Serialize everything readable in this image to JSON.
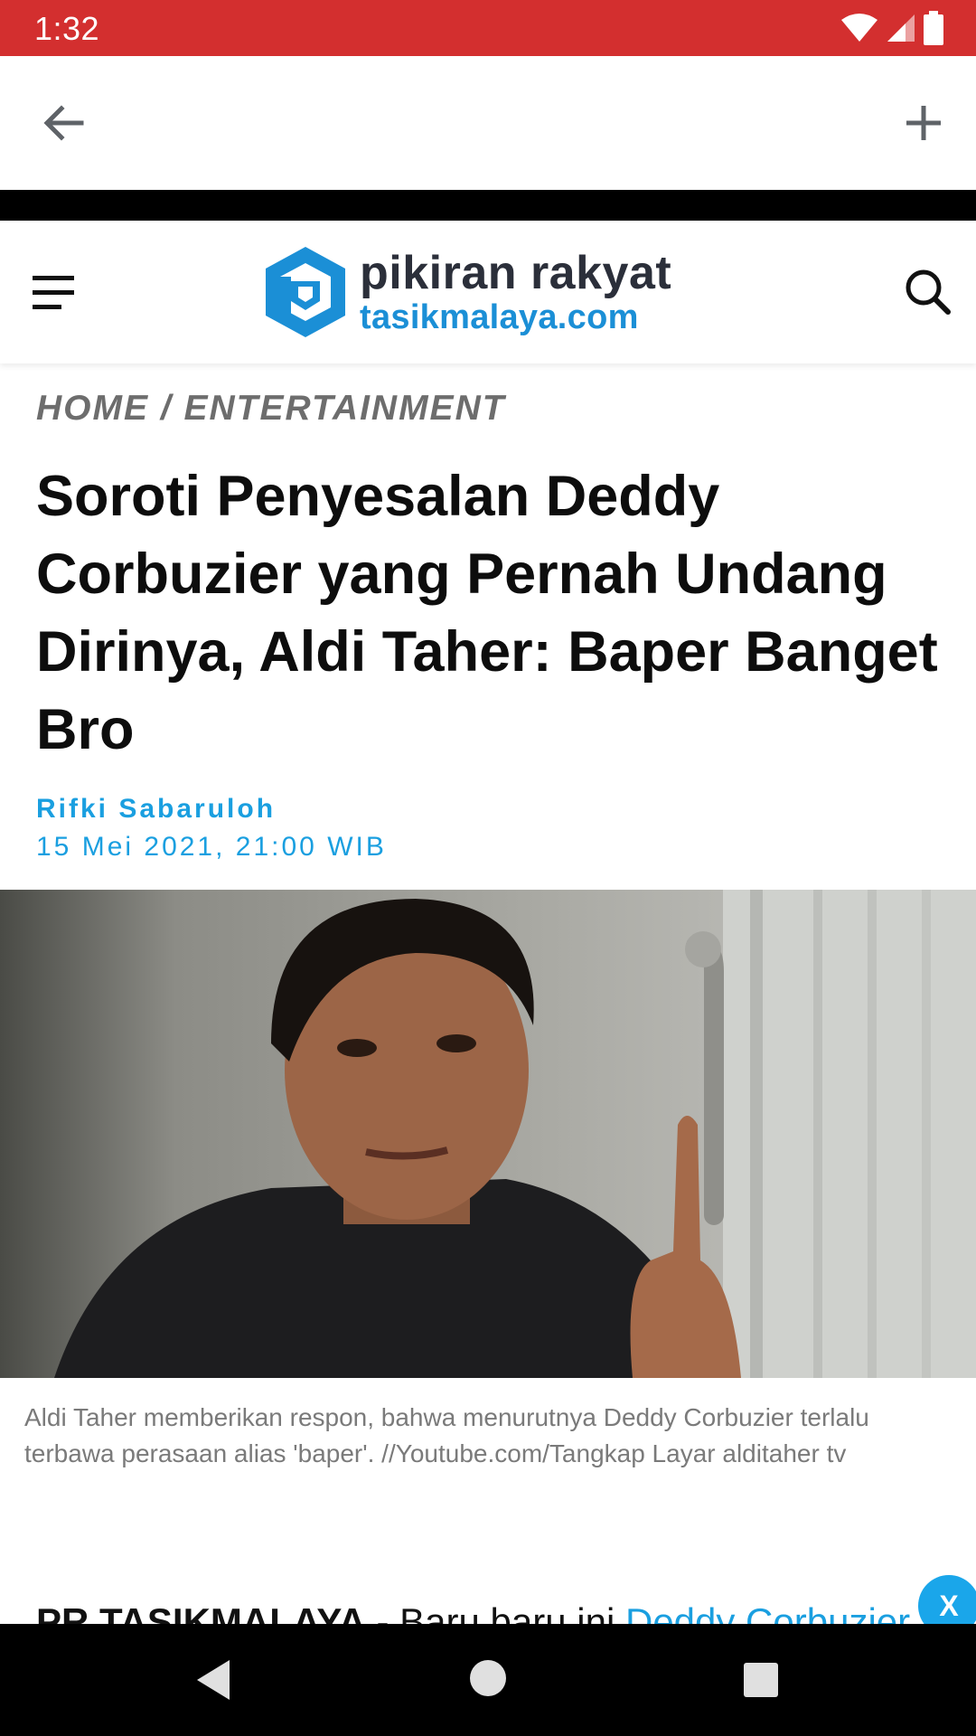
{
  "status_bar": {
    "time": "1:32",
    "icons": [
      "wifi-icon",
      "cell-signal-icon",
      "battery-icon"
    ],
    "color": "#d32f2f"
  },
  "app_bar": {
    "icons": [
      "back-arrow-icon",
      "plus-icon"
    ]
  },
  "site_header": {
    "logo_line1": "pikiran rakyat",
    "logo_line2": "tasikmalaya.com",
    "icons": [
      "hamburger-menu-icon",
      "search-icon",
      "site-logo-icon"
    ],
    "brand_color": "#1b8fd6"
  },
  "article": {
    "breadcrumb": "HOME / ENTERTAINMENT",
    "headline": "Soroti Penyesalan Deddy Corbuzier yang Pernah Undang Dirinya, Aldi Taher: Baper Banget Bro",
    "author": "Rifki Sabaruloh",
    "date": "15 Mei 2021, 21:00 WIB",
    "caption": "Aldi Taher memberikan respon, bahwa menurutnya Deddy Corbuzier terlalu terbawa perasaan alias 'baper'. //Youtube.com/Tangkap Layar alditaher tv",
    "body_lead": "PR TASIKMALAYA",
    "body_text": " - Baru baru ini ",
    "body_link": "Deddy Corbuzier",
    "link_color": "#1a9fe0"
  },
  "ad": {
    "close_label": "X"
  },
  "nav_bar": {
    "icons": [
      "nav-back-icon",
      "nav-home-icon",
      "nav-recents-icon"
    ]
  }
}
